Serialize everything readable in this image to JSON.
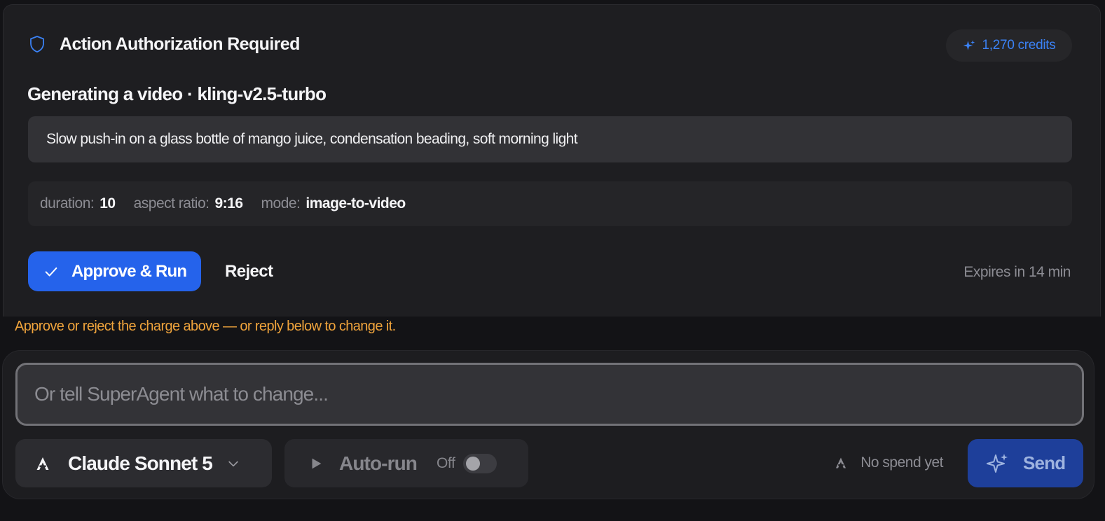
{
  "card": {
    "title": "Action Authorization Required",
    "title_icon": "shield-icon",
    "credits_icon": "sparkle-icon",
    "credits_label": "1,270 credits",
    "job_title": "Generating a video · kling-v2.5-turbo",
    "prompt": "Slow push-in on a glass bottle of mango juice, condensation beading, soft morning light",
    "params": [
      {
        "key": "duration:",
        "value": "10"
      },
      {
        "key": "aspect ratio:",
        "value": "9:16"
      },
      {
        "key": "mode:",
        "value": "image-to-video"
      }
    ],
    "approve_icon": "check-icon",
    "approve_label": "Approve & Run",
    "reject_label": "Reject",
    "expires": "Expires in 14 min"
  },
  "warning": "Approve or reject the charge above — or reply below to change it.",
  "composer": {
    "placeholder": "Or tell SuperAgent what to change...",
    "model_icon": "anthropic-logo-icon",
    "model_label": "Claude Sonnet 5",
    "autorun_icon": "play-icon",
    "autorun_label": "Auto-run",
    "autorun_state": "Off",
    "autorun_enabled": false,
    "spend_icon": "anthropic-logo-icon",
    "spend_label": "No spend yet",
    "send_icon": "sparkle-icon",
    "send_label": "Send"
  },
  "colors": {
    "accent": "#2563eb",
    "credits": "#3b82f6",
    "warning": "#f0a43c",
    "send_disabled": "#1e3f9a"
  }
}
